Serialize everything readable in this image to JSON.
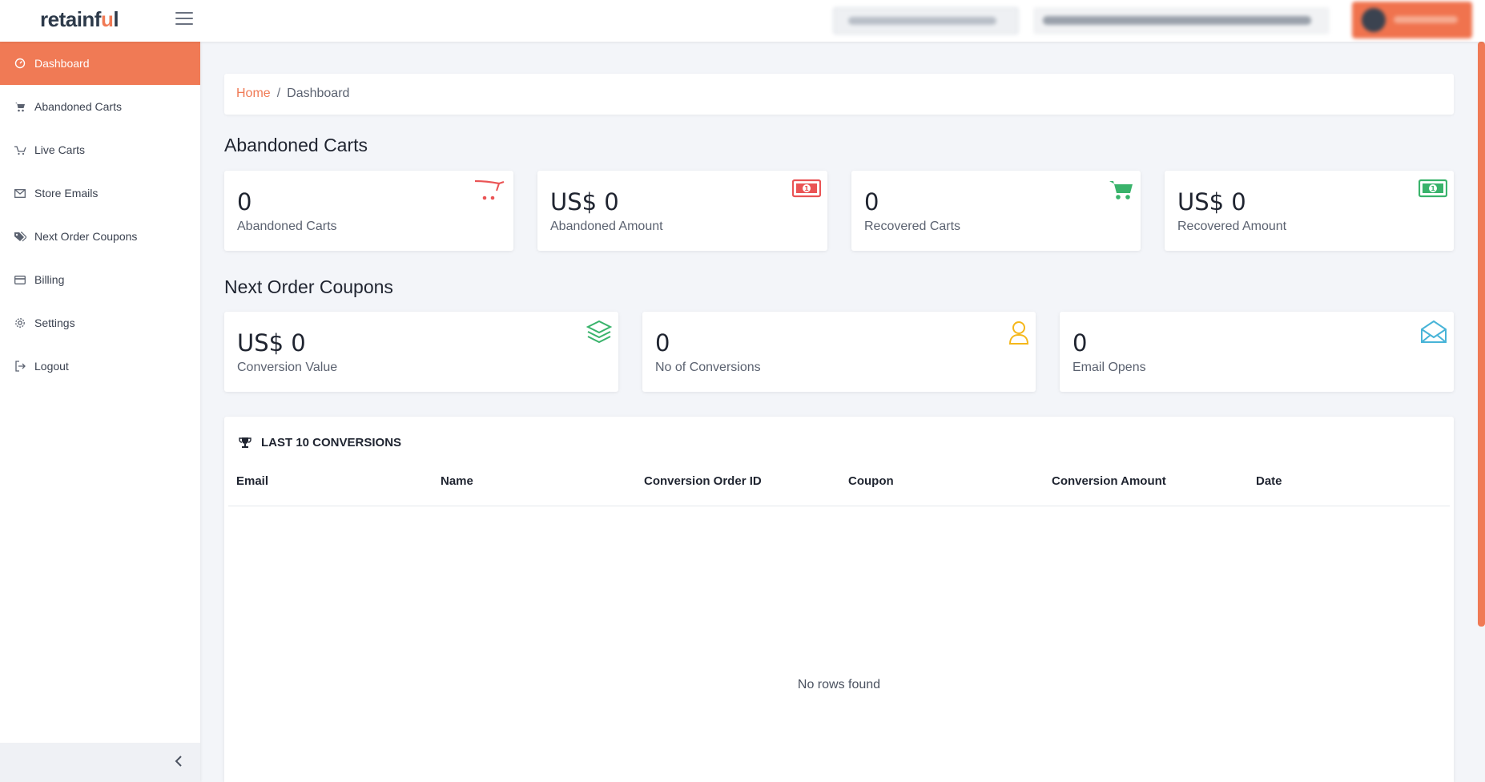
{
  "brand": {
    "name_prefix": "retainf",
    "name_accent": "u",
    "name_suffix": "l"
  },
  "colors": {
    "accent": "#f07a55",
    "green": "#39b36b",
    "red": "#ea5455",
    "yellow": "#f5b71a",
    "blue": "#48b4d8"
  },
  "sidebar": {
    "items": [
      {
        "label": "Dashboard",
        "icon": "dashboard-icon"
      },
      {
        "label": "Abandoned Carts",
        "icon": "cart-icon"
      },
      {
        "label": "Live Carts",
        "icon": "live-cart-icon"
      },
      {
        "label": "Store Emails",
        "icon": "mail-icon"
      },
      {
        "label": "Next Order Coupons",
        "icon": "tags-icon"
      },
      {
        "label": "Billing",
        "icon": "credit-card-icon"
      },
      {
        "label": "Settings",
        "icon": "gear-icon"
      },
      {
        "label": "Logout",
        "icon": "logout-icon"
      }
    ]
  },
  "breadcrumb": {
    "home": "Home",
    "separator": "/",
    "current": "Dashboard"
  },
  "abandoned_section": {
    "title": "Abandoned Carts",
    "cards": [
      {
        "value": "0",
        "label": "Abandoned Carts",
        "icon": "cart-icon"
      },
      {
        "value": "US$ 0",
        "label": "Abandoned Amount",
        "icon": "money-icon"
      },
      {
        "value": "0",
        "label": "Recovered Carts",
        "icon": "shopping-cart-icon"
      },
      {
        "value": "US$ 0",
        "label": "Recovered Amount",
        "icon": "money-icon"
      }
    ]
  },
  "coupons_section": {
    "title": "Next Order Coupons",
    "cards": [
      {
        "value": "US$ 0",
        "label": "Conversion Value",
        "icon": "layers-icon"
      },
      {
        "value": "0",
        "label": "No of Conversions",
        "icon": "user-icon"
      },
      {
        "value": "0",
        "label": "Email Opens",
        "icon": "envelope-open-icon"
      }
    ]
  },
  "conversions_table": {
    "title": "LAST 10 CONVERSIONS",
    "columns": [
      "Email",
      "Name",
      "Conversion Order ID",
      "Coupon",
      "Conversion Amount",
      "Date"
    ],
    "empty_text": "No rows found"
  }
}
